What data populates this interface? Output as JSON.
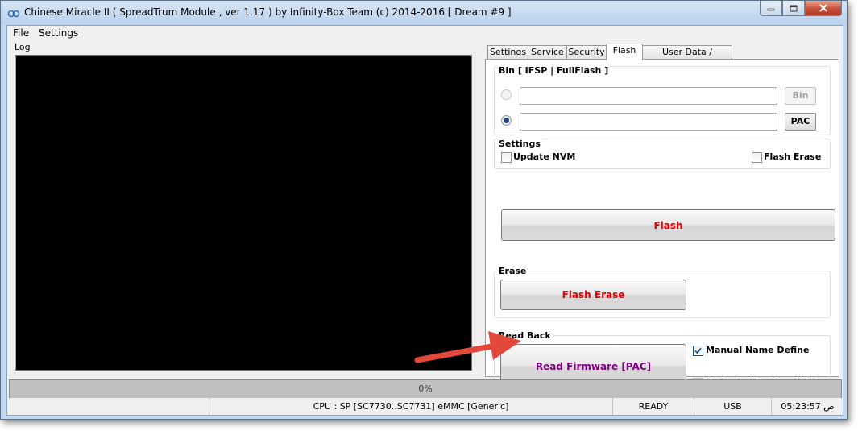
{
  "window": {
    "title": "Chinese Miracle II ( SpreadTrum Module , ver 1.17 ) by Infinity-Box Team (c) 2014-2016 [ Dream #9 ]"
  },
  "menu": {
    "file": "File",
    "settings": "Settings"
  },
  "log": {
    "label": "Log"
  },
  "tabs": [
    {
      "label": "Settings",
      "active": false
    },
    {
      "label": "Service",
      "active": false
    },
    {
      "label": "Security",
      "active": false
    },
    {
      "label": "Flash",
      "active": true
    },
    {
      "label": "User Data / Forensic",
      "active": false
    }
  ],
  "flash_tab": {
    "bin_group": {
      "title": "Bin  [ IFSP | FullFlash ]",
      "bin_radio_selected": false,
      "bin_path_value": "",
      "bin_button": "Bin",
      "pac_radio_selected": true,
      "pac_path_value": "",
      "pac_button": "PAC"
    },
    "settings_group": {
      "title": "Settings",
      "update_nvm": {
        "label": "Update NVM",
        "checked": false
      },
      "flash_erase": {
        "label": "Flash Erase",
        "checked": false
      }
    },
    "flash_button": "Flash",
    "erase_group": {
      "title": "Erase",
      "flash_erase_button": "Flash Erase"
    },
    "readback_group": {
      "title": "Read Back",
      "read_firmware_button": "Read Firmware [PAC]",
      "manual_name_define": {
        "label": "Manual Name Define",
        "checked": true
      },
      "make_calibration": {
        "label": "Make Calibration [NV]",
        "checked": false,
        "enabled": false
      }
    }
  },
  "progress": {
    "text": "0%",
    "value": 0
  },
  "status": {
    "cpu": "CPU : SP [SC7730..SC7731] eMMC [Generic]",
    "state": "READY",
    "connection": "USB",
    "time": "05:23:57 ص"
  },
  "colors": {
    "flash_text": "#e00000",
    "read_firmware_text": "#800080",
    "arrow": "#e2493a",
    "log_background": "#000000"
  }
}
